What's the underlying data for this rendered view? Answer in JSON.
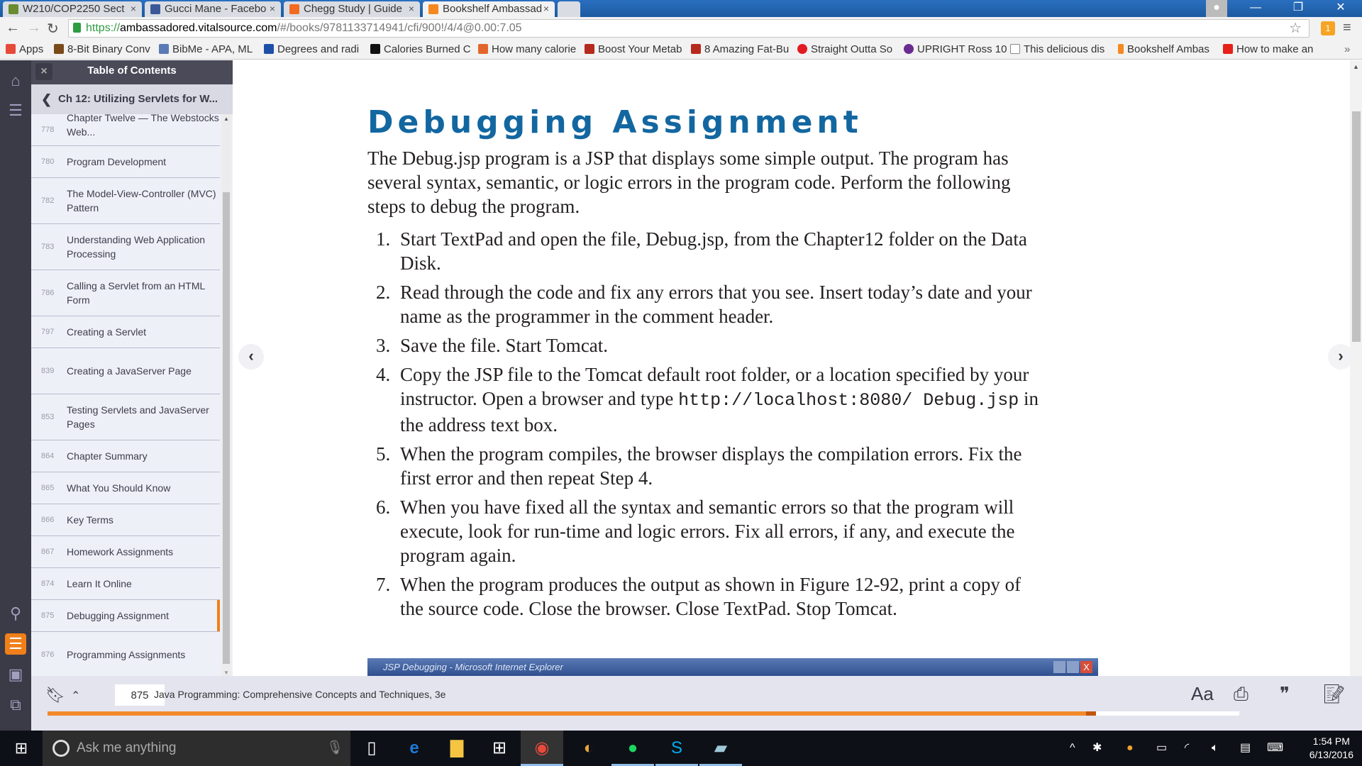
{
  "browser": {
    "tabs": [
      {
        "label": "W210/COP2250 Sect",
        "icon_color": "#6a8c2e",
        "active": false
      },
      {
        "label": "Gucci Mane - Facebo",
        "icon_color": "#3b5998",
        "active": false
      },
      {
        "label": "Chegg Study | Guide",
        "icon_color": "#f26b21",
        "active": false
      },
      {
        "label": "Bookshelf Ambassad",
        "icon_color": "#f5891f",
        "active": true
      }
    ],
    "url_scheme": "https://",
    "url_host": "ambassadored.vitalsource.com",
    "url_path": "/#/books/9781133714941/cfi/900!/4/4@0.00:7.05",
    "extension_badge": "1",
    "bookmarks": [
      {
        "label": "Apps",
        "icon_color": "#e64a3b"
      },
      {
        "label": "8-Bit Binary Conv",
        "icon_color": "#7a4a1a"
      },
      {
        "label": "BibMe - APA, ML",
        "icon_color": "#5a7ab5"
      },
      {
        "label": "Degrees and radi",
        "icon_color": "#1e4fa8"
      },
      {
        "label": "Calories Burned C",
        "icon_color": "#111111"
      },
      {
        "label": "How many calorie",
        "icon_color": "#e2662b"
      },
      {
        "label": "Boost Your Metab",
        "icon_color": "#b52a1c"
      },
      {
        "label": "8 Amazing Fat-Bu",
        "icon_color": "#b52a1c"
      },
      {
        "label": "Straight Outta So",
        "icon_color": "#e31b23"
      },
      {
        "label": "UPRIGHT Ross 10",
        "icon_color": "#6a2c91"
      },
      {
        "label": "This delicious dis",
        "icon_color": "#cccccc"
      },
      {
        "label": "Bookshelf Ambas",
        "icon_color": "#f5891f"
      },
      {
        "label": "How to make an",
        "icon_color": "#e62117"
      }
    ],
    "overflow_label": "»"
  },
  "sidebar": {
    "title": "Table of Contents",
    "close_label": "×",
    "chapter": "Ch 12: Utilizing Servlets for W...",
    "items": [
      {
        "page": "778",
        "title": "Chapter Twelve — The Webstocks Web...",
        "lines": 2
      },
      {
        "page": "780",
        "title": "Program Development",
        "lines": 1
      },
      {
        "page": "782",
        "title": "The Model-View-Controller (MVC) Pattern",
        "lines": 2
      },
      {
        "page": "783",
        "title": "Understanding Web Application Processing",
        "lines": 2
      },
      {
        "page": "786",
        "title": "Calling a Servlet from an HTML Form",
        "lines": 2
      },
      {
        "page": "797",
        "title": "Creating a Servlet",
        "lines": 1
      },
      {
        "page": "839",
        "title": "Creating a JavaServer Page",
        "lines": 2
      },
      {
        "page": "853",
        "title": "Testing Servlets and JavaServer Pages",
        "lines": 2
      },
      {
        "page": "864",
        "title": "Chapter Summary",
        "lines": 1
      },
      {
        "page": "865",
        "title": "What You Should Know",
        "lines": 1
      },
      {
        "page": "866",
        "title": "Key Terms",
        "lines": 1
      },
      {
        "page": "867",
        "title": "Homework Assignments",
        "lines": 1
      },
      {
        "page": "874",
        "title": "Learn It Online",
        "lines": 1
      },
      {
        "page": "875",
        "title": "Debugging Assignment",
        "lines": 1,
        "selected": true
      },
      {
        "page": "876",
        "title": "Programming Assignments",
        "lines": 2
      }
    ]
  },
  "content": {
    "heading": "Debugging Assignment",
    "intro": "The Debug.jsp program is a JSP that displays some simple output. The program has several syntax, semantic, or logic errors in the program code. Perform the following steps to debug the program.",
    "steps": [
      {
        "num": "1.",
        "text": "Start TextPad and open the file, Debug.jsp, from the Chapter12 folder on the Data Disk."
      },
      {
        "num": "2.",
        "text": "Read through the code and fix any errors that you see. Insert today’s date and your name as the programmer in the comment header."
      },
      {
        "num": "3.",
        "text": "Save the file. Start Tomcat."
      },
      {
        "num": "4.",
        "text_before": "Copy the JSP file to the Tomcat default root folder, or a location specified by your instructor. Open a browser and type ",
        "code": "http://localhost:8080/ Debug.jsp",
        "text_after": " in the address text box."
      },
      {
        "num": "5.",
        "text": "When the program compiles, the browser displays the compilation errors. Fix the first error and then repeat Step 4."
      },
      {
        "num": "6.",
        "text": "When you have fixed all the syntax and semantic errors so that the program will execute, look for run-time and logic errors. Fix all errors, if any, and execute the program again."
      },
      {
        "num": "7.",
        "text": "When the program produces the output as shown in Figure 12-92, print a copy of the source code. Close the browser. Close TextPad. Stop Tomcat."
      }
    ],
    "figure_title": "JSP Debugging - Microsoft Internet Explorer"
  },
  "bottombar": {
    "page_number": "875",
    "book_title": "Java Programming: Comprehensive Concepts and Techniques, 3e",
    "font_label": "Aa",
    "reading_progress_percent": 88
  },
  "taskbar": {
    "search_placeholder": "Ask me anything",
    "time": "1:54 PM",
    "date": "6/13/2016"
  },
  "colors": {
    "accent": "#f07f1a",
    "heading": "#1367a0"
  }
}
